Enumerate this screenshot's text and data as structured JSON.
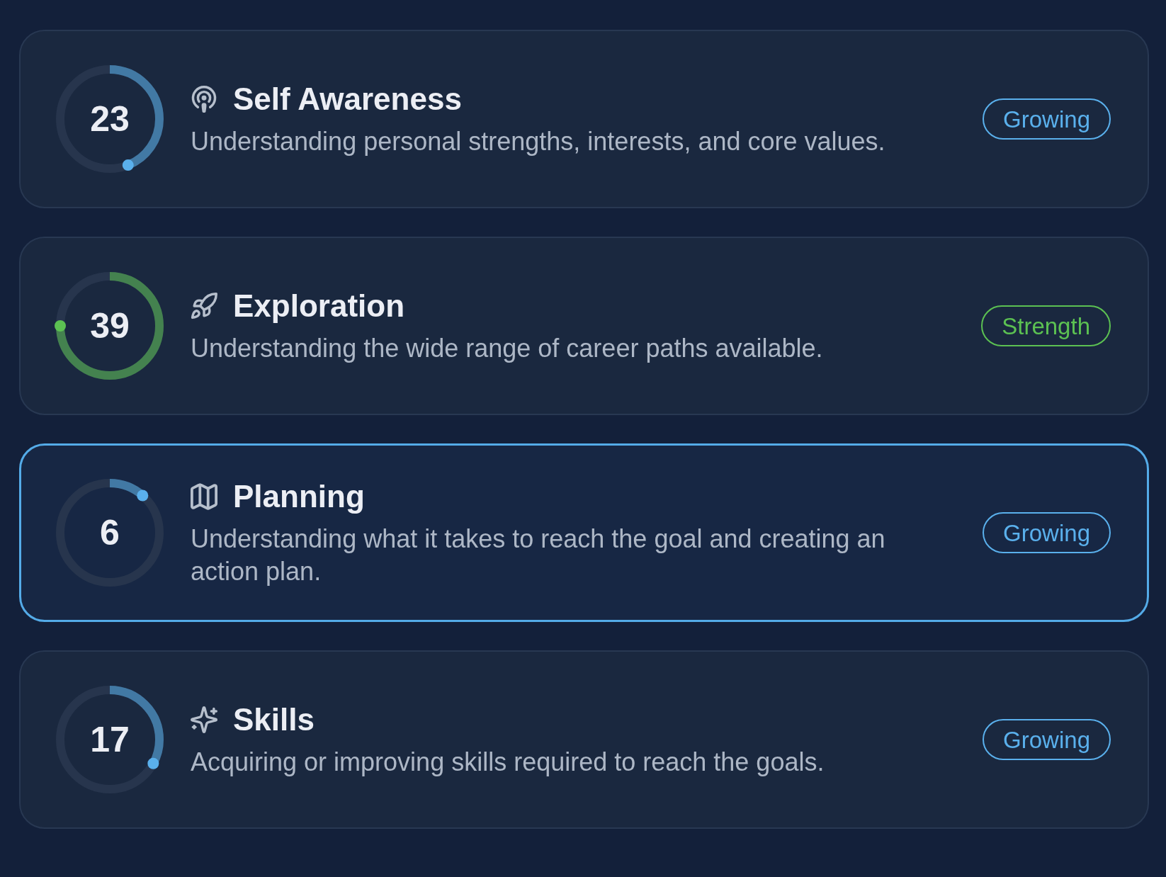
{
  "items": [
    {
      "score": "23",
      "level": 0.44,
      "title": "Self Awareness",
      "description": "Understanding personal strengths, interests, and core values.",
      "status": "Growing",
      "color": "#5ab0ec",
      "selected": false
    },
    {
      "score": "39",
      "level": 0.75,
      "title": "Exploration",
      "description": "Understanding the wide range of career paths available.",
      "status": "Strength",
      "color": "#5cc152",
      "selected": false
    },
    {
      "score": "6",
      "level": 0.115,
      "title": "Planning",
      "description": "Understanding what it takes to reach the goal and creating an action plan.",
      "status": "Growing",
      "color": "#5ab0ec",
      "selected": true
    },
    {
      "score": "17",
      "level": 0.33,
      "title": "Skills",
      "description": "Acquiring or improving skills required to reach the goals.",
      "status": "Growing",
      "color": "#5ab0ec",
      "selected": false
    }
  ]
}
